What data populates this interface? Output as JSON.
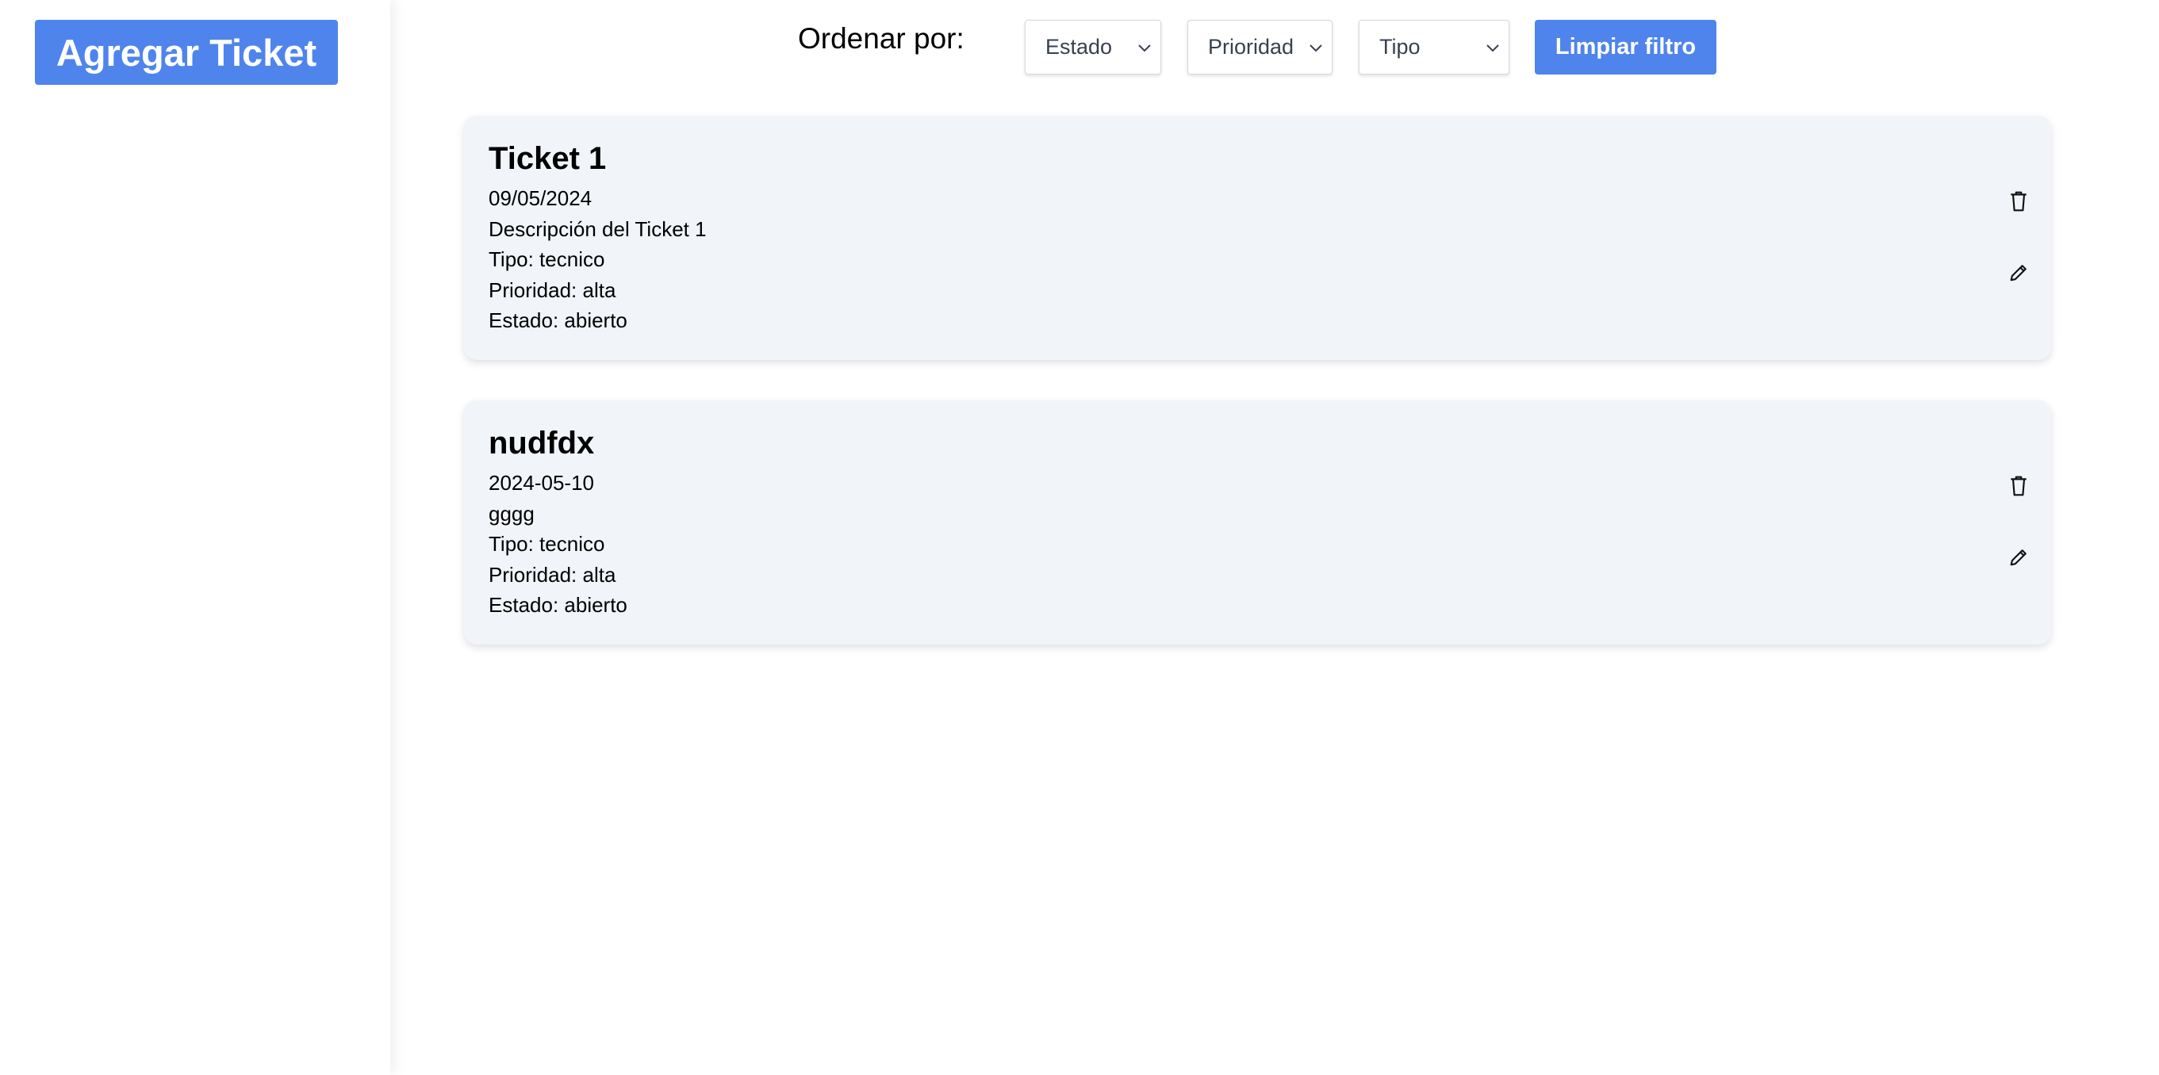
{
  "sidebar": {
    "add_button_label": "Agregar Ticket"
  },
  "toolbar": {
    "sort_label": "Ordenar por:",
    "filters": [
      {
        "label": "Estado"
      },
      {
        "label": "Prioridad"
      },
      {
        "label": "Tipo"
      }
    ],
    "clear_button_label": "Limpiar filtro"
  },
  "tickets": [
    {
      "title": "Ticket 1",
      "date": "09/05/2024",
      "description": "Descripción del Ticket 1",
      "tipo": "Tipo: tecnico",
      "prioridad": "Prioridad: alta",
      "estado": "Estado: abierto"
    },
    {
      "title": "nudfdx",
      "date": "2024-05-10",
      "description": "gggg",
      "tipo": "Tipo: tecnico",
      "prioridad": "Prioridad: alta",
      "estado": "Estado: abierto"
    }
  ],
  "icons": {
    "delete": "trash-icon",
    "edit": "pencil-icon",
    "dropdown": "chevron-down-icon"
  },
  "colors": {
    "accent": "#4f84ec",
    "card_bg": "#f1f4f9"
  }
}
